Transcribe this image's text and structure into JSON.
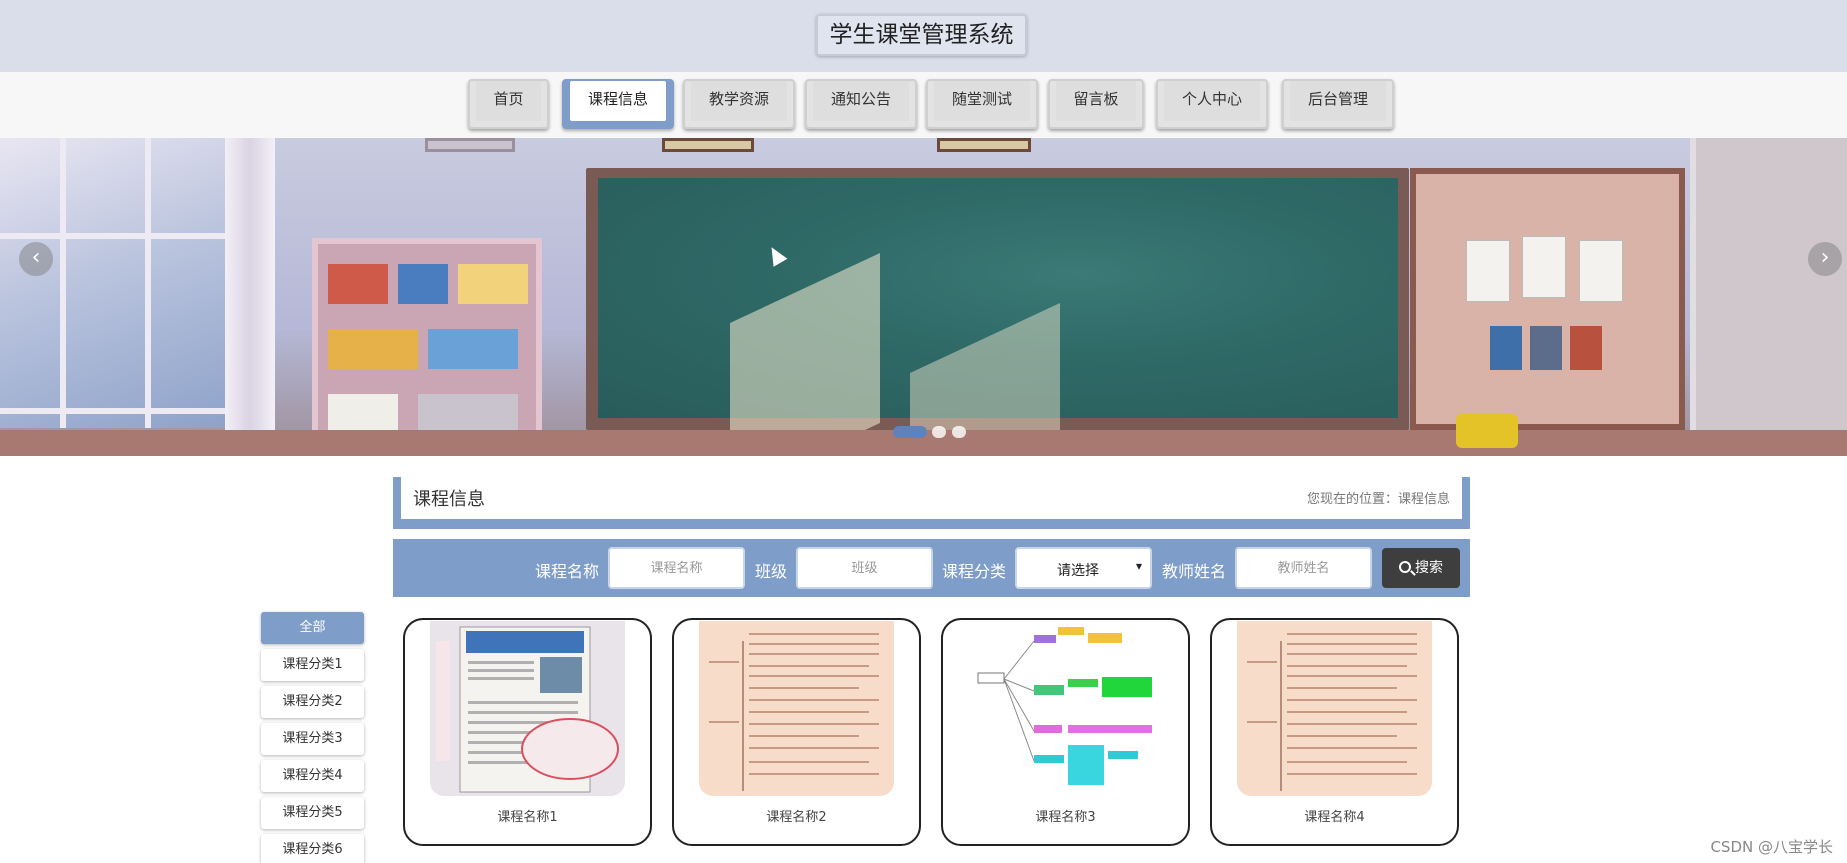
{
  "header": {
    "title": "学生课堂管理系统"
  },
  "nav": {
    "items": [
      {
        "label": "首页"
      },
      {
        "label": "课程信息",
        "active": true
      },
      {
        "label": "教学资源"
      },
      {
        "label": "通知公告"
      },
      {
        "label": "随堂测试"
      },
      {
        "label": "留言板"
      },
      {
        "label": "个人中心"
      },
      {
        "label": "后台管理"
      }
    ]
  },
  "carousel": {
    "prev": "‹",
    "next": "›",
    "slides": 3,
    "active_slide": 1
  },
  "section": {
    "title": "课程信息",
    "breadcrumb": "您现在的位置：课程信息"
  },
  "search": {
    "course_name_label": "课程名称",
    "course_name_placeholder": "课程名称",
    "class_label": "班级",
    "class_placeholder": "班级",
    "category_label": "课程分类",
    "category_value": "请选择",
    "teacher_label": "教师姓名",
    "teacher_placeholder": "教师姓名",
    "button_label": "搜索"
  },
  "categories": [
    {
      "label": "全部",
      "active": true
    },
    {
      "label": "课程分类1"
    },
    {
      "label": "课程分类2"
    },
    {
      "label": "课程分类3"
    },
    {
      "label": "课程分类4"
    },
    {
      "label": "课程分类5"
    },
    {
      "label": "课程分类6"
    }
  ],
  "courses": [
    {
      "name": "课程名称1"
    },
    {
      "name": "课程名称2"
    },
    {
      "name": "课程名称3"
    },
    {
      "name": "课程名称4"
    }
  ],
  "watermark": "CSDN @八宝学长",
  "colors": {
    "accent": "#7e9ec9",
    "topbar": "#d9deea",
    "search_button": "#3e3e3e"
  }
}
